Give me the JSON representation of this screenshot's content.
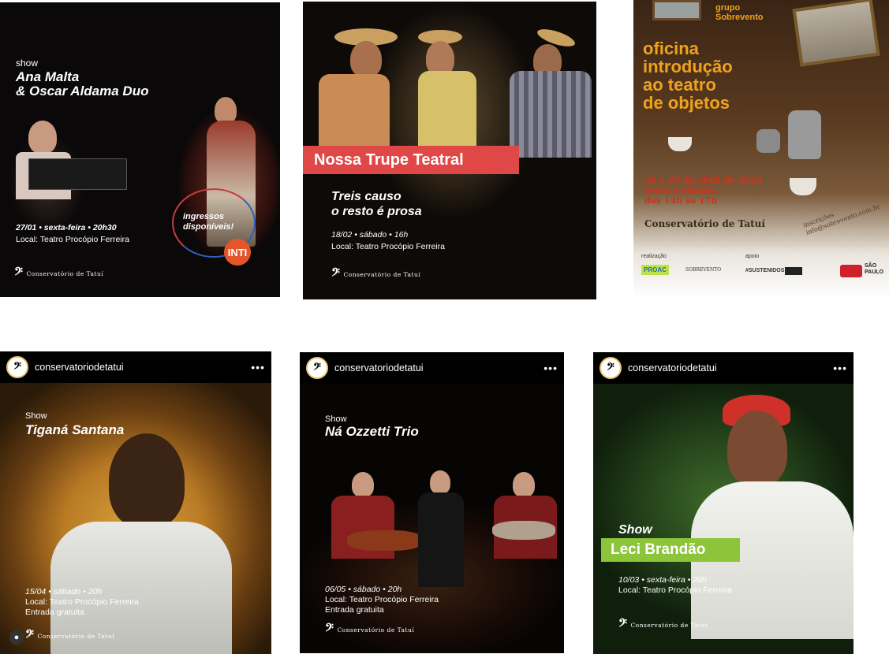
{
  "cards": [
    {
      "kicker": "show",
      "title_line1": "Ana Malta",
      "title_line2": "& Oscar Aldama Duo",
      "date": "27/01 • sexta-feira • 20h30",
      "venue": "Local: Teatro Procópio Ferreira",
      "badge_line1": "ingressos",
      "badge_line2": "disponíveis!",
      "badge_brand": "INTI",
      "logo_text": "Conservatório de Tatuí"
    },
    {
      "banner": "Nossa Trupe Teatral",
      "title_line1": "Treis causo",
      "title_line2": "o resto é prosa",
      "date": "18/02 • sábado • 16h",
      "venue": "Local: Teatro Procópio Ferreira",
      "logo_text": "Conservatório de Tatuí"
    },
    {
      "group_line1": "grupo",
      "group_line2": "Sobrevento",
      "title_lines": [
        "oficina",
        "introdução",
        "ao teatro",
        "de objetos"
      ],
      "dates_lines": [
        "28 e 29 de abril de 2023",
        "sexta e sábado,",
        "das 14h às 17h"
      ],
      "place": "Conservatório de Tatuí",
      "inscricoes": "inscrições",
      "email": "info@sobrevento.com.br",
      "realizacao_label": "realização",
      "apoio_label": "apoio",
      "sponsor_proac": "PROAC",
      "sponsor_sobrevento": "SOBREVENTO",
      "sponsor_sustenidos": "#SUSTENIDOS",
      "sponsor_sp_line1": "SÃO",
      "sponsor_sp_line2": "PAULO"
    },
    {
      "ig_user": "conservatoriodetatui",
      "kicker": "Show",
      "title": "Tiganá Santana",
      "date": "15/04 • sábado • 20h",
      "venue": "Local: Teatro Procópio Ferreira",
      "extra": "Entrada gratuita",
      "logo_text": "Conservatório de Tatuí"
    },
    {
      "ig_user": "conservatoriodetatui",
      "kicker": "Show",
      "title": "Ná Ozzetti Trio",
      "date": "06/05 • sábado • 20h",
      "venue": "Local: Teatro Procópio Ferreira",
      "extra": "Entrada gratuita",
      "logo_text": "Conservatório de Tatuí"
    },
    {
      "ig_user": "conservatoriodetatui",
      "kicker": "Show",
      "banner": "Leci Brandão",
      "date": "10/03 • sexta-feira • 20h",
      "venue": "Local: Teatro Procópio Ferreira",
      "logo_text": "Conservatório de Tatuí"
    }
  ],
  "icons": {
    "clef": "bass-clef-icon",
    "more": "more-horizontal-icon",
    "user": "user-icon"
  },
  "colors": {
    "banner_red": "#e04848",
    "banner_green": "#8cc43a",
    "title_orange": "#f0a21e",
    "date_red": "#d0321c",
    "inti_orange": "#e4562a"
  }
}
